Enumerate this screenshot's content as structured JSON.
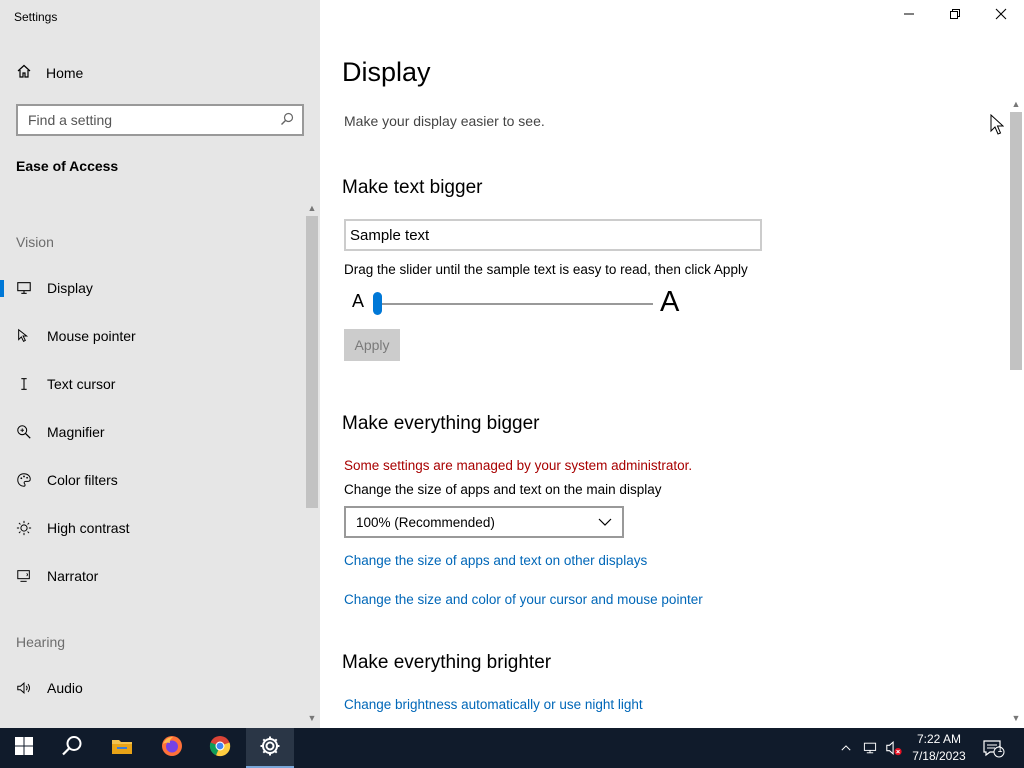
{
  "window": {
    "title": "Settings"
  },
  "sidebar": {
    "home_label": "Home",
    "search_placeholder": "Find a setting",
    "section_title": "Ease of Access",
    "groups": {
      "vision": "Vision",
      "hearing": "Hearing"
    },
    "items": [
      {
        "label": "Display",
        "icon": "monitor-icon",
        "active": true
      },
      {
        "label": "Mouse pointer",
        "icon": "mouse-pointer-icon",
        "active": false
      },
      {
        "label": "Text cursor",
        "icon": "text-cursor-icon",
        "active": false
      },
      {
        "label": "Magnifier",
        "icon": "magnifier-icon",
        "active": false
      },
      {
        "label": "Color filters",
        "icon": "color-filters-icon",
        "active": false
      },
      {
        "label": "High contrast",
        "icon": "high-contrast-icon",
        "active": false
      },
      {
        "label": "Narrator",
        "icon": "narrator-icon",
        "active": false
      },
      {
        "label": "Audio",
        "icon": "audio-icon",
        "active": false
      }
    ]
  },
  "main": {
    "title": "Display",
    "subtitle": "Make your display easier to see.",
    "text_bigger": {
      "heading": "Make text bigger",
      "sample_text": "Sample text",
      "hint": "Drag the slider until the sample text is easy to read, then click Apply",
      "small_glyph": "A",
      "large_glyph": "A",
      "slider_value_fraction": 0,
      "apply_label": "Apply"
    },
    "everything_bigger": {
      "heading": "Make everything bigger",
      "admin_warning": "Some settings are managed by your system administrator.",
      "scale_label": "Change the size of apps and text on the main display",
      "scale_value": "100% (Recommended)",
      "link_other_displays": "Change the size of apps and text on other displays",
      "link_cursor": "Change the size and color of your cursor and mouse pointer"
    },
    "everything_brighter": {
      "heading": "Make everything brighter",
      "link_brightness": "Change brightness automatically or use night light"
    }
  },
  "taskbar": {
    "apps": [
      "start-icon",
      "search-icon",
      "file-explorer-icon",
      "firefox-icon",
      "chrome-icon",
      "settings-icon"
    ],
    "time": "7:22 AM",
    "date": "7/18/2023",
    "notification_count": "1"
  },
  "colors": {
    "accent": "#0078d7",
    "link": "#0067b8",
    "warning": "#a80000",
    "sidebar_bg": "#e6e6e6",
    "taskbar_bg": "#101b2b"
  }
}
